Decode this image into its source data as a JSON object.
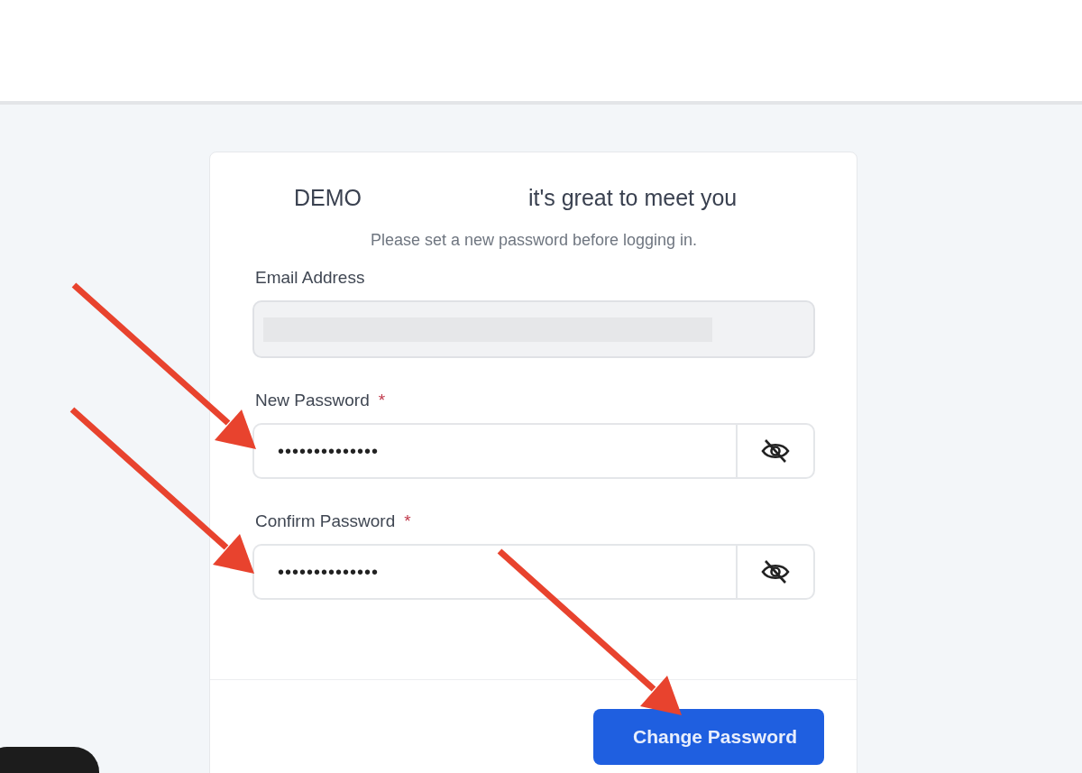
{
  "card": {
    "title_start": "DEMO",
    "title_end": "it's great to meet you",
    "subtitle": "Please set a new password before logging in.",
    "fields": [
      {
        "kind": "email",
        "label": "Email Address",
        "disabled": true,
        "redacted": true
      },
      {
        "kind": "password",
        "label": "New Password",
        "required_mark": "*",
        "value": "••••••••••••••",
        "visible": false
      },
      {
        "kind": "password",
        "label": "Confirm Password",
        "required_mark": "*",
        "value": "••••••••••••••",
        "visible": false
      }
    ],
    "button": "Change Password"
  }
}
